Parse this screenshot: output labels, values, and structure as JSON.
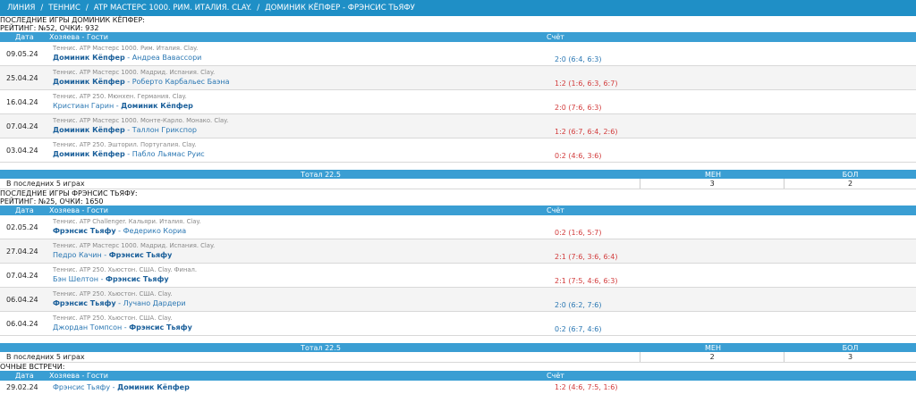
{
  "breadcrumb": [
    "ЛИНИЯ",
    "/",
    "ТЕННИС",
    "/",
    "ATP МАСТЕРС 1000. РИМ. ИТАЛИЯ. CLAY.",
    "/",
    "ДОМИНИК КЁПФЕР - ФРЭНСИС ТЬЯФУ"
  ],
  "headers": {
    "date": "Дата",
    "teams": "Хозяева - Гости",
    "score": "Счёт"
  },
  "section1": {
    "title": "ПОСЛЕДНИЕ ИГРЫ ДОМИНИК КЁПФЕР:",
    "rating": "РЕЙТИНГ: №52, ОЧКИ: 932",
    "rows": [
      {
        "date": "09.05.24",
        "tour": "Теннис. ATP Мастерс 1000. Рим. Италия. Clay.",
        "home": "Доминик Кёпфер",
        "away": "Андреа Вавассори",
        "score": "2:0 (6:4, 6:3)",
        "result": "win",
        "bold": "home"
      },
      {
        "date": "25.04.24",
        "tour": "Теннис. ATP Мастерс 1000. Мадрид. Испания. Clay.",
        "home": "Доминик Кёпфер",
        "away": "Роберто Карбальес Баэна",
        "score": "1:2 (1:6, 6:3, 6:7)",
        "result": "loss",
        "bold": "home"
      },
      {
        "date": "16.04.24",
        "tour": "Теннис. ATP 250. Мюнхен. Германия. Clay.",
        "home": "Кристиан Гарин",
        "away": "Доминик Кёпфер",
        "score": "2:0 (7:6, 6:3)",
        "result": "loss",
        "bold": "away"
      },
      {
        "date": "07.04.24",
        "tour": "Теннис. ATP Мастерс 1000. Монте-Карло. Монако. Clay.",
        "home": "Доминик Кёпфер",
        "away": "Таллон Грикспор",
        "score": "1:2 (6:7, 6:4, 2:6)",
        "result": "loss",
        "bold": "home"
      },
      {
        "date": "03.04.24",
        "tour": "Теннис. ATP 250. Эшторил. Португалия. Clay.",
        "home": "Доминик Кёпфер",
        "away": "Пабло Льямас Руис",
        "score": "0:2 (4:6, 3:6)",
        "result": "loss",
        "bold": "home"
      }
    ],
    "total_label": "Тотал 22.5",
    "men_label": "МЕН",
    "bol_label": "БОЛ",
    "count_label": "В последних 5 играх",
    "men": "3",
    "bol": "2"
  },
  "section2": {
    "title": "ПОСЛЕДНИЕ ИГРЫ ФРЭНСИС ТЬЯФУ:",
    "rating": "РЕЙТИНГ: №25, ОЧКИ: 1650",
    "rows": [
      {
        "date": "02.05.24",
        "tour": "Теннис. ATP Challenger. Кальяри. Италия. Clay.",
        "home": "Фрэнсис Тьяфу",
        "away": "Федерико Кориа",
        "score": "0:2 (1:6, 5:7)",
        "result": "loss",
        "bold": "home"
      },
      {
        "date": "27.04.24",
        "tour": "Теннис. ATP Мастерс 1000. Мадрид. Испания. Clay.",
        "home": "Педро Качин",
        "away": "Фрэнсис Тьяфу",
        "score": "2:1 (7:6, 3:6, 6:4)",
        "result": "loss",
        "bold": "away"
      },
      {
        "date": "07.04.24",
        "tour": "Теннис. ATP 250. Хьюстон. США. Clay. Финал.",
        "home": "Бэн Шелтон",
        "away": "Фрэнсис Тьяфу",
        "score": "2:1 (7:5, 4:6, 6:3)",
        "result": "loss",
        "bold": "away"
      },
      {
        "date": "06.04.24",
        "tour": "Теннис. ATP 250. Хьюстон. США. Clay.",
        "home": "Фрэнсис Тьяфу",
        "away": "Лучано Дардери",
        "score": "2:0 (6:2, 7:6)",
        "result": "win",
        "bold": "home"
      },
      {
        "date": "06.04.24",
        "tour": "Теннис. ATP 250. Хьюстон. США. Clay.",
        "home": "Джордан Томпсон",
        "away": "Фрэнсис Тьяфу",
        "score": "0:2 (6:7, 4:6)",
        "result": "win",
        "bold": "away"
      }
    ],
    "total_label": "Тотал 22.5",
    "men_label": "МЕН",
    "bol_label": "БОЛ",
    "count_label": "В последних 5 играх",
    "men": "2",
    "bol": "3"
  },
  "section3": {
    "title": "ОЧНЫЕ ВСТРЕЧИ:",
    "rows": [
      {
        "date": "29.02.24",
        "home": "Фрэнсис Тьяфу",
        "away": "Доминик Кёпфер",
        "score": "1:2 (4:6, 7:5, 1:6)",
        "result": "loss",
        "bold": "away"
      }
    ]
  },
  "colors": {
    "header": "#3a9ed3",
    "topbar": "#1f8fc6",
    "win": "#2a77b3",
    "loss": "#d23b3b"
  }
}
